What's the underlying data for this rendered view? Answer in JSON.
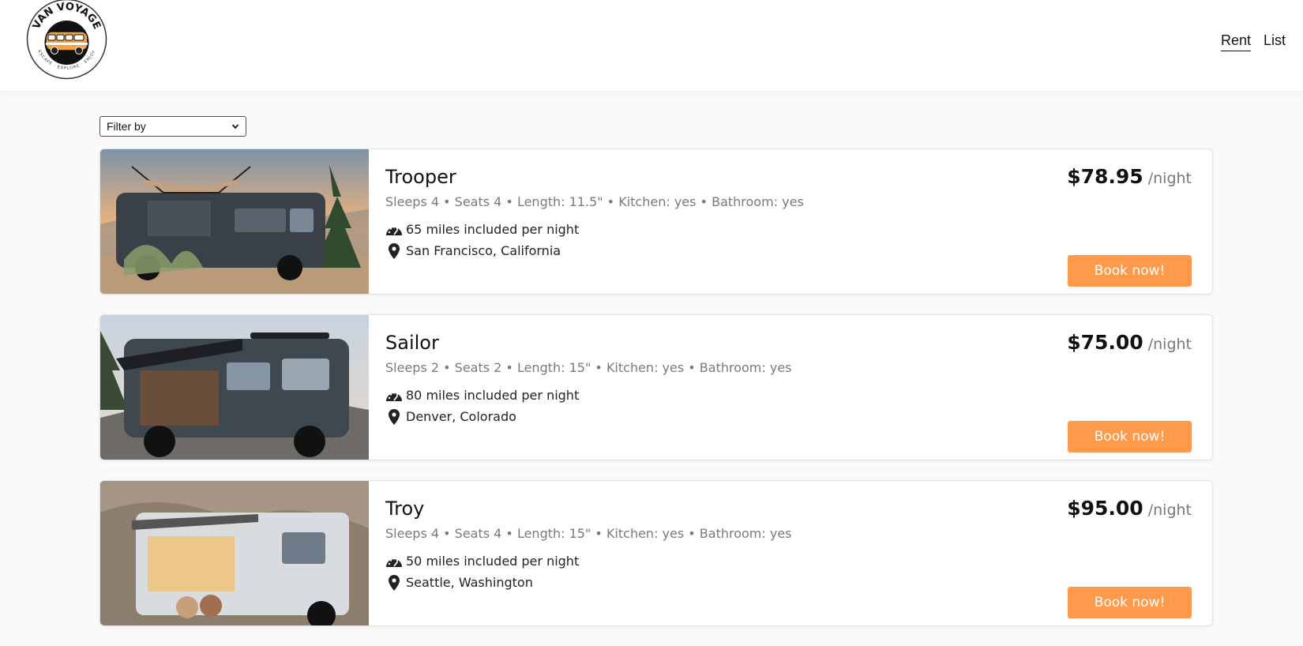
{
  "brand": {
    "logo_text_top": "VAN VOYAGE",
    "logo_text_bottom": "ESCAPE · EXPLORE · ENJOY",
    "colors": {
      "accent": "#ff9a4d",
      "van_body": "#f5a23f"
    }
  },
  "nav": {
    "items": [
      {
        "label": "Rent",
        "active": true
      },
      {
        "label": "List",
        "active": false
      }
    ]
  },
  "filter": {
    "selected": "Filter by"
  },
  "listings": [
    {
      "name": "Trooper",
      "specs": "Sleeps 4 • Seats 4 • Length: 11.5\" • Kitchen: yes • Bathroom: yes",
      "miles": "65 miles included per night",
      "location": "San Francisco, California",
      "price": "$78.95",
      "unit": "/night",
      "cta": "Book now!"
    },
    {
      "name": "Sailor",
      "specs": "Sleeps 2 • Seats 2 • Length: 15\" • Kitchen: yes • Bathroom: yes",
      "miles": "80 miles included per night",
      "location": "Denver, Colorado",
      "price": "$75.00",
      "unit": "/night",
      "cta": "Book now!"
    },
    {
      "name": "Troy",
      "specs": "Sleeps 4 • Seats 4 • Length: 15\" • Kitchen: yes • Bathroom: yes",
      "miles": "50 miles included per night",
      "location": "Seattle, Washington",
      "price": "$95.00",
      "unit": "/night",
      "cta": "Book now!"
    }
  ],
  "icons": {
    "miles": "speedometer-icon",
    "location": "map-pin-icon",
    "filter": "chevron-down-icon"
  }
}
